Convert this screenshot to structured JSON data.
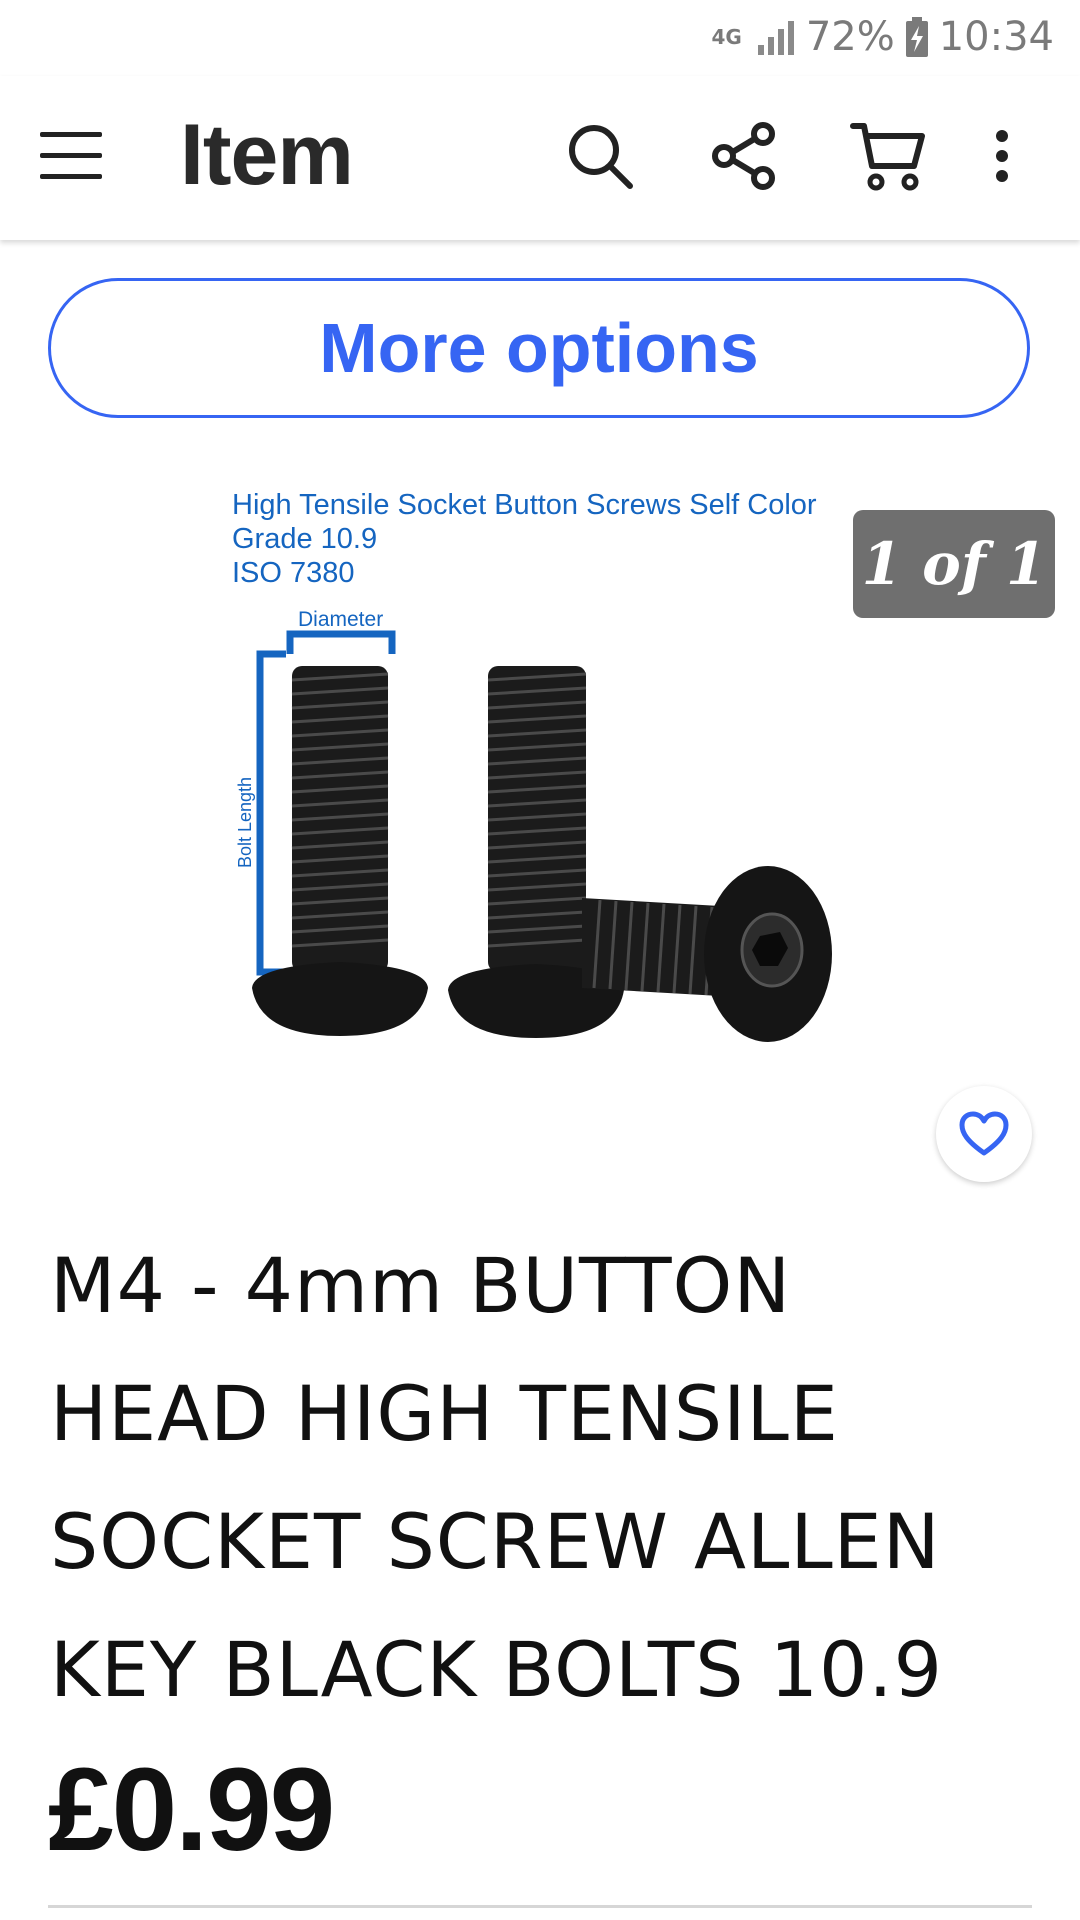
{
  "status_bar": {
    "network": "4G",
    "battery": "72%",
    "time": "10:34"
  },
  "app_bar": {
    "title": "Item",
    "icons": [
      "menu-icon",
      "search-icon",
      "share-icon",
      "cart-icon",
      "more-vert-icon"
    ]
  },
  "more_options_label": "More options",
  "product_image": {
    "caption_line1": "High Tensile Socket Button Screws Self Color",
    "caption_line2": "Grade 10.9",
    "caption_line3": "ISO 7380",
    "diameter_label": "Diameter",
    "length_label": "Bolt Length"
  },
  "image_counter": "1 of 1",
  "item": {
    "title": "M4 - 4mm BUTTON HEAD HIGH TENSILE SOCKET SCREW ALLEN KEY BLACK BOLTS 10.9",
    "price": "£0.99"
  },
  "colors": {
    "accent": "#3665f3",
    "image_caption": "#1565c0",
    "counter_bg": "#6f6f6f"
  }
}
